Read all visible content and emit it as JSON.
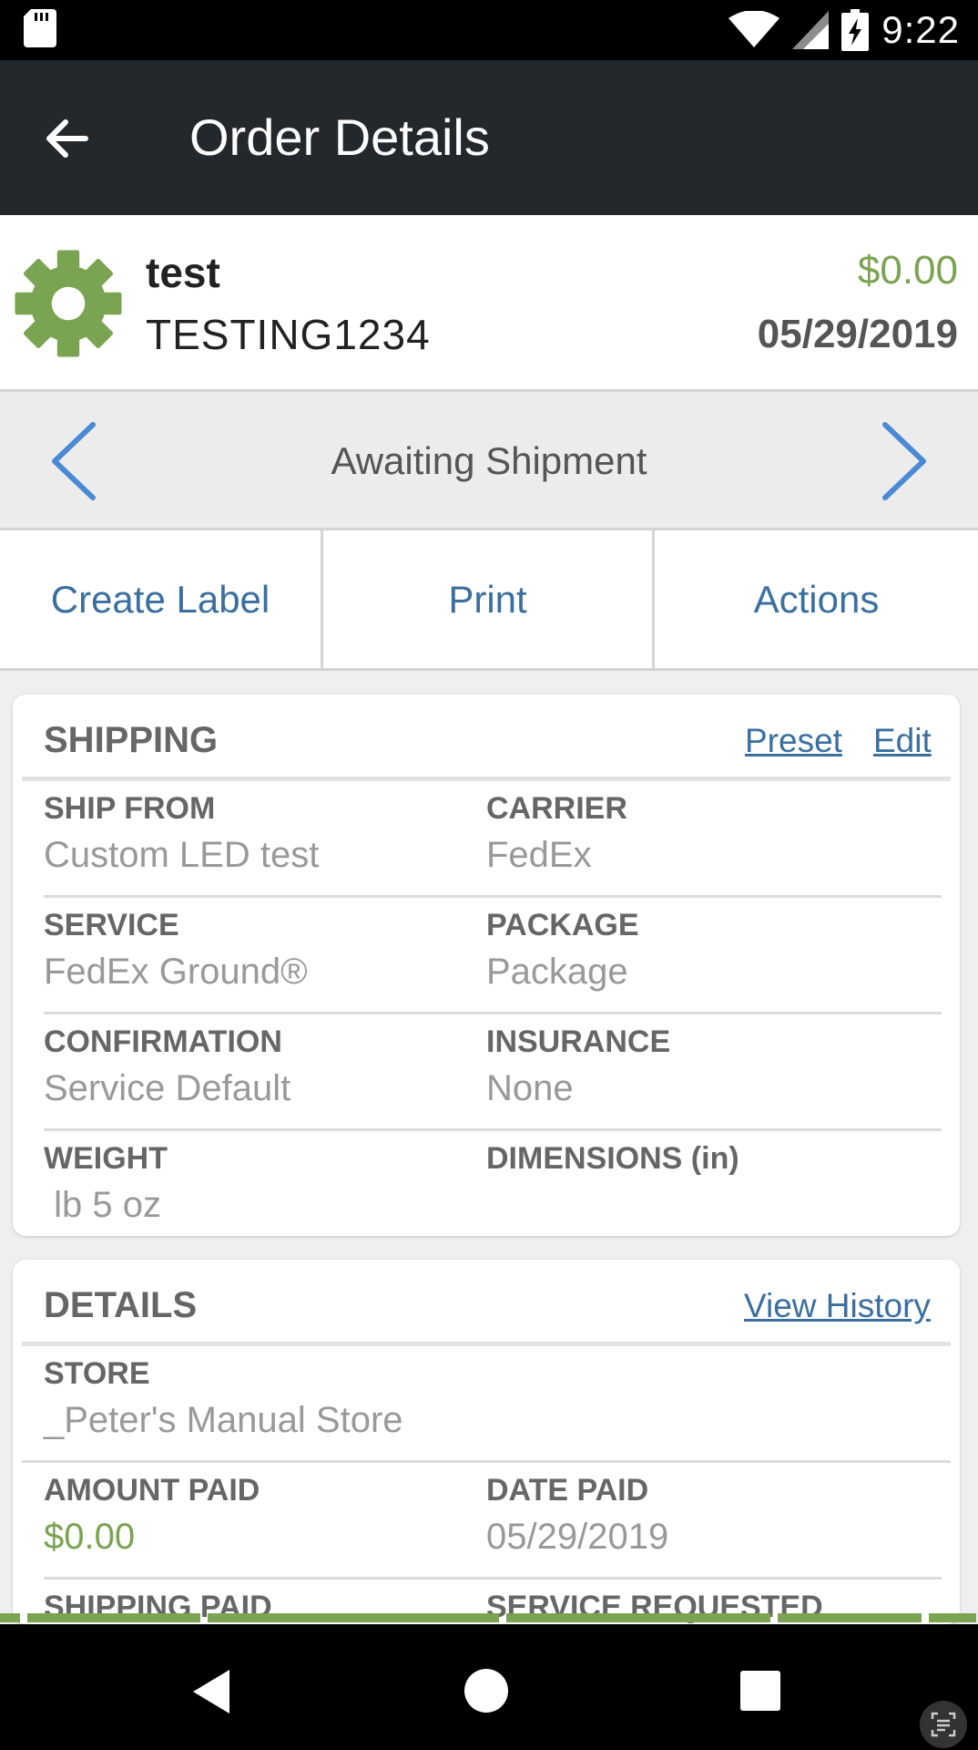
{
  "status_bar": {
    "time": "9:22",
    "icons": [
      "sd-card-icon",
      "wifi-icon",
      "signal-icon",
      "battery-charging-icon"
    ]
  },
  "app_bar": {
    "title": "Order Details",
    "back_icon": "arrow-left-icon"
  },
  "order": {
    "icon": "gear-icon",
    "name": "test",
    "number": "TESTING1234",
    "amount": "$0.00",
    "date": "05/29/2019",
    "amount_color": "#7aa352"
  },
  "status_nav": {
    "label": "Awaiting Shipment",
    "prev_icon": "chevron-left-icon",
    "next_icon": "chevron-right-icon"
  },
  "actions": [
    {
      "label": "Create Label"
    },
    {
      "label": "Print"
    },
    {
      "label": "Actions"
    }
  ],
  "shipping": {
    "title": "SHIPPING",
    "preset_label": "Preset",
    "edit_label": "Edit",
    "fields": {
      "ship_from": {
        "label": "SHIP FROM",
        "value": "Custom LED test"
      },
      "carrier": {
        "label": "CARRIER",
        "value": "FedEx"
      },
      "service": {
        "label": "SERVICE",
        "value": "FedEx Ground®"
      },
      "package": {
        "label": "PACKAGE",
        "value": "Package"
      },
      "confirmation": {
        "label": "CONFIRMATION",
        "value": "Service Default"
      },
      "insurance": {
        "label": "INSURANCE",
        "value": "None"
      },
      "weight": {
        "label": "WEIGHT",
        "value": " lb 5 oz"
      },
      "dimensions": {
        "label": "DIMENSIONS (in)",
        "value": ""
      }
    }
  },
  "details": {
    "title": "DETAILS",
    "history_label": "View History",
    "fields": {
      "store": {
        "label": "STORE",
        "value": "_Peter's Manual Store"
      },
      "amount_paid": {
        "label": "AMOUNT PAID",
        "value": "$0.00"
      },
      "date_paid": {
        "label": "DATE PAID",
        "value": "05/29/2019"
      },
      "shipping_paid": {
        "label": "SHIPPING PAID"
      },
      "service_requested": {
        "label": "SERVICE REQUESTED"
      }
    }
  },
  "nav_bar": {
    "icons": [
      "back-triangle-icon",
      "home-circle-icon",
      "recents-square-icon",
      "screen-text-icon"
    ]
  },
  "colors": {
    "app_bar": "#22282c",
    "accent_blue": "#3a6f9f",
    "chevron_blue": "#4a8ad4",
    "green": "#7aa352"
  }
}
